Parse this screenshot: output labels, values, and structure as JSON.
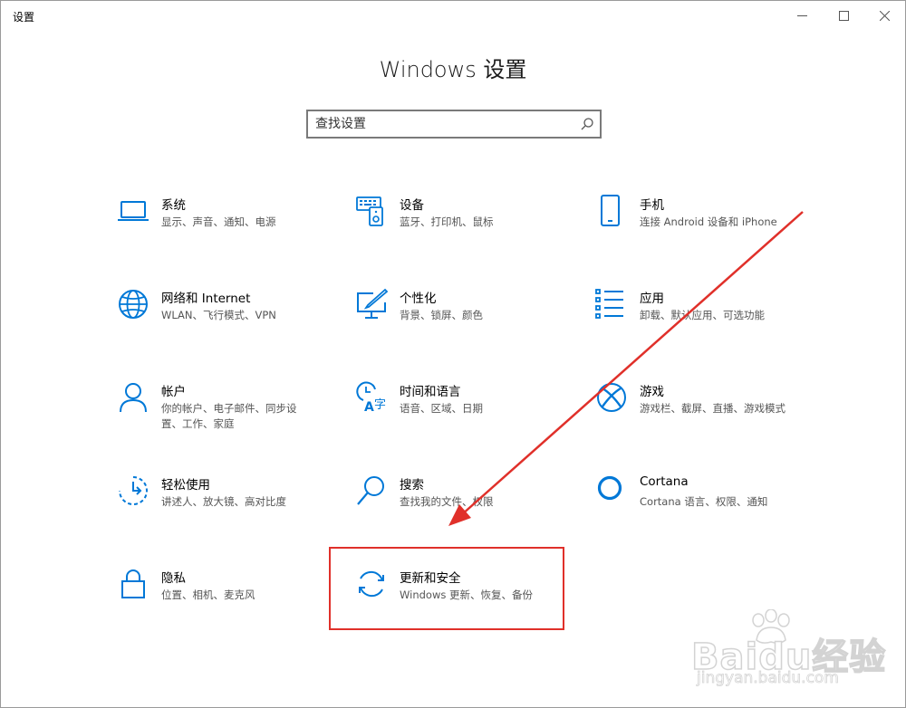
{
  "window": {
    "title": "设置"
  },
  "heading": "Windows 设置",
  "search": {
    "placeholder": "查找设置"
  },
  "tiles": [
    {
      "title": "系统",
      "subtitle": "显示、声音、通知、电源",
      "icon": "laptop-icon"
    },
    {
      "title": "设备",
      "subtitle": "蓝牙、打印机、鼠标",
      "icon": "devices-icon"
    },
    {
      "title": "手机",
      "subtitle": "连接 Android 设备和 iPhone",
      "icon": "phone-icon"
    },
    {
      "title": "网络和 Internet",
      "subtitle": "WLAN、飞行模式、VPN",
      "icon": "globe-icon"
    },
    {
      "title": "个性化",
      "subtitle": "背景、锁屏、颜色",
      "icon": "personalization-icon"
    },
    {
      "title": "应用",
      "subtitle": "卸载、默认应用、可选功能",
      "icon": "apps-list-icon"
    },
    {
      "title": "帐户",
      "subtitle": "你的帐户、电子邮件、同步设置、工作、家庭",
      "icon": "person-icon"
    },
    {
      "title": "时间和语言",
      "subtitle": "语音、区域、日期",
      "icon": "time-language-icon"
    },
    {
      "title": "游戏",
      "subtitle": "游戏栏、截屏、直播、游戏模式",
      "icon": "xbox-icon"
    },
    {
      "title": "轻松使用",
      "subtitle": "讲述人、放大镜、高对比度",
      "icon": "ease-of-access-icon"
    },
    {
      "title": "搜索",
      "subtitle": "查找我的文件、权限",
      "icon": "search-icon"
    },
    {
      "title": "Cortana",
      "subtitle": "Cortana 语言、权限、通知",
      "icon": "cortana-icon"
    },
    {
      "title": "隐私",
      "subtitle": "位置、相机、麦克风",
      "icon": "lock-icon"
    },
    {
      "title": "更新和安全",
      "subtitle": "Windows 更新、恢复、备份",
      "icon": "update-sync-icon"
    }
  ],
  "watermark": {
    "main": "Baidu经验",
    "sub": "jingyan.baidu.com"
  },
  "colors": {
    "accent": "#0078d7",
    "annotation": "#e0302a"
  }
}
